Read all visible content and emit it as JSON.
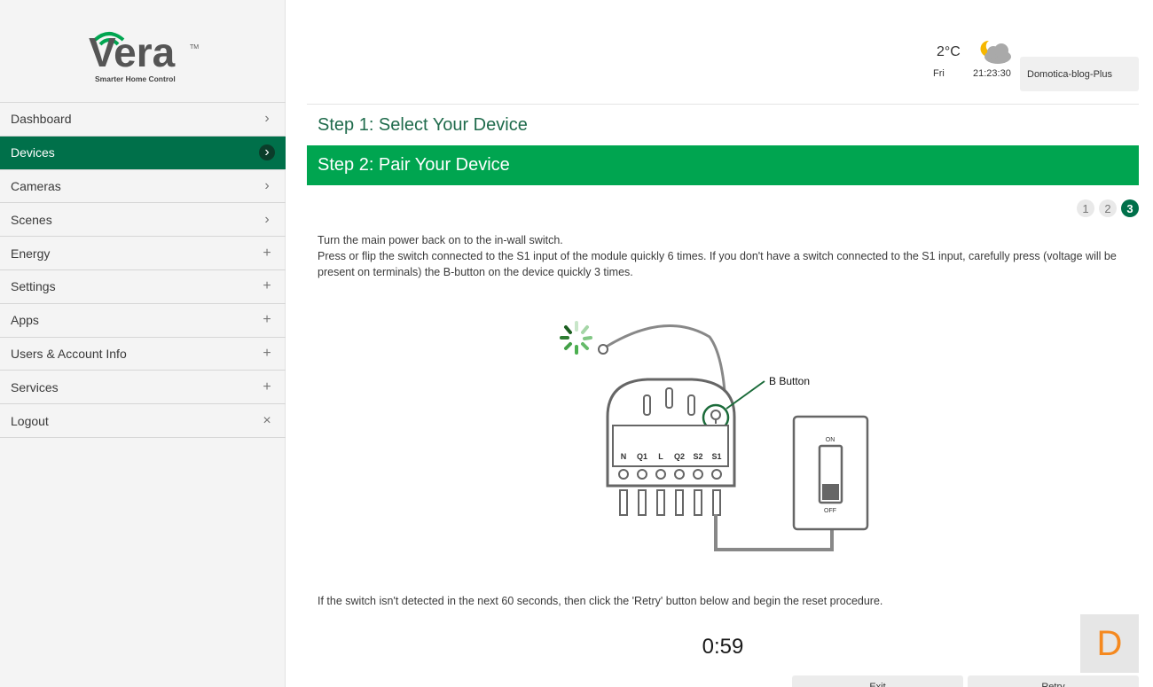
{
  "brand": {
    "logo_text": "Vera",
    "tm": "TM",
    "tagline": "Smarter Home Control"
  },
  "sidebar": {
    "items": [
      {
        "label": "Dashboard",
        "icon": "chevron-right-icon",
        "glyph": "›"
      },
      {
        "label": "Devices",
        "icon": "chevron-right-icon",
        "glyph": "›",
        "active": true
      },
      {
        "label": "Cameras",
        "icon": "chevron-right-icon",
        "glyph": "›"
      },
      {
        "label": "Scenes",
        "icon": "chevron-right-icon",
        "glyph": "›"
      },
      {
        "label": "Energy",
        "icon": "plus-icon",
        "glyph": "+"
      },
      {
        "label": "Settings",
        "icon": "plus-icon",
        "glyph": "+"
      },
      {
        "label": "Apps",
        "icon": "plus-icon",
        "glyph": "+"
      },
      {
        "label": "Users & Account Info",
        "icon": "plus-icon",
        "glyph": "+"
      },
      {
        "label": "Services",
        "icon": "plus-icon",
        "glyph": "+"
      },
      {
        "label": "Logout",
        "icon": "close-icon",
        "glyph": "×"
      }
    ]
  },
  "header": {
    "temperature": "2°C",
    "day": "Fri",
    "time": "21:23:30",
    "weather_icon": "partly-cloudy-night-icon",
    "account": "Domotica-blog-Plus"
  },
  "wizard": {
    "step1_title": "Step 1: Select Your Device",
    "step2_title": "Step 2: Pair Your Device",
    "pages": [
      "1",
      "2",
      "3"
    ],
    "active_page": "3",
    "instructions": [
      "Turn the main power back on to the in-wall switch.",
      "Press or flip the switch connected to the S1 input of the module quickly 6 times. If you don't have a switch connected to the S1 input, carefully press (voltage will be present on terminals) the B-button on the device quickly 3 times."
    ],
    "illustration": {
      "b_button_label": "B Button",
      "terminals": [
        "N",
        "Q1",
        "L",
        "Q2",
        "S2",
        "S1"
      ],
      "switch_on": "ON",
      "switch_off": "OFF"
    },
    "retry_note": "If the switch isn't detected in the next 60 seconds, then click the 'Retry' button below and begin the reset procedure.",
    "timer": "0:59",
    "exit_label": "Exit",
    "retry_label": "Retry"
  },
  "fab": {
    "label": "D"
  },
  "colors": {
    "accent_dark": "#00704a",
    "accent_bright": "#00a550",
    "fab_text": "#f5891f"
  }
}
